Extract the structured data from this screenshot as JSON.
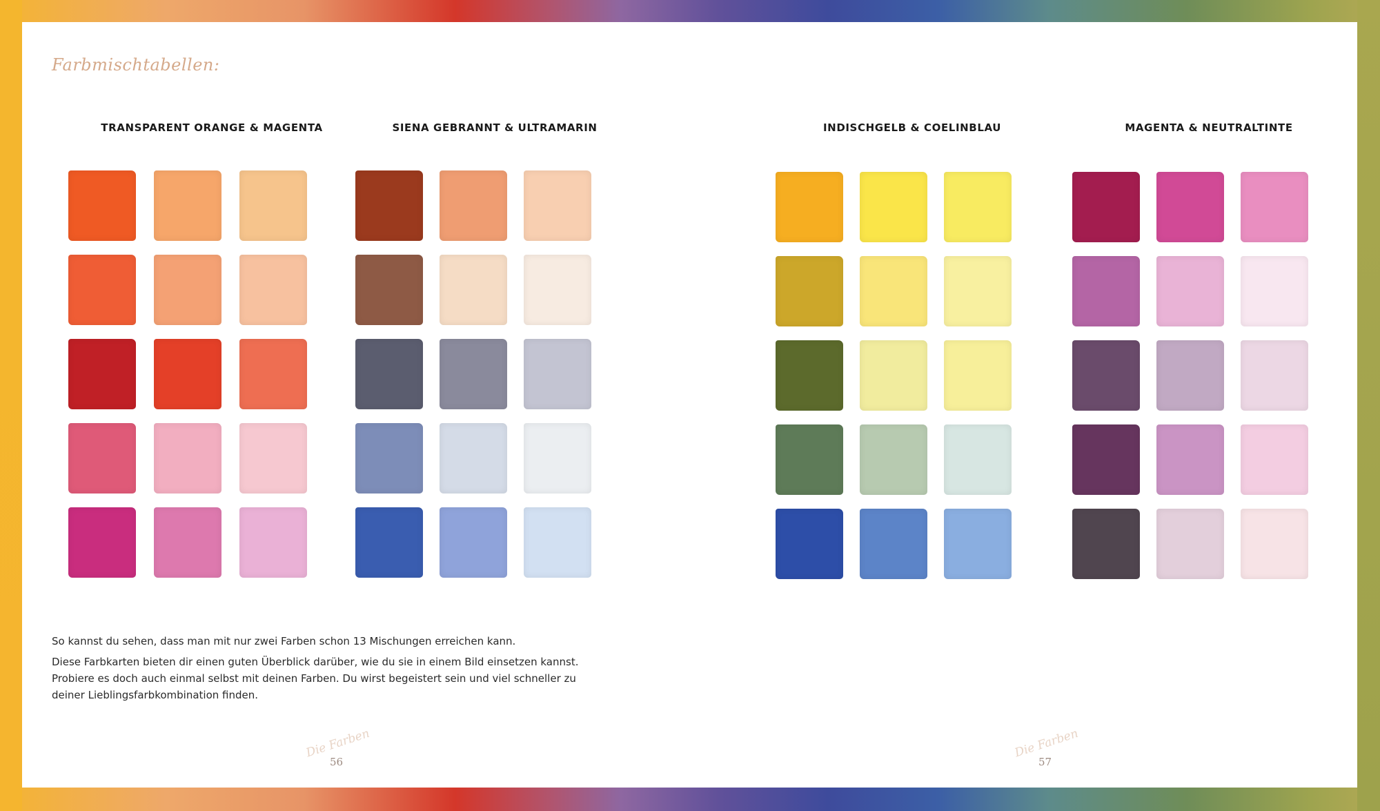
{
  "header": {
    "title": "Farbmischtabellen:"
  },
  "columns": [
    {
      "title": "TRANSPARENT ORANGE & MAGENTA",
      "swatches": [
        "#ef5a24",
        "#f6a66a",
        "#f6c48c",
        "#ef5d35",
        "#f4a174",
        "#f7c19f",
        "#c02026",
        "#e44028",
        "#ee6e52",
        "#df5a78",
        "#f2aec0",
        "#f6c8d0",
        "#c92d7e",
        "#dd79ae",
        "#eab1d6"
      ]
    },
    {
      "title": "SIENA GEBRANNT & ULTRAMARIN",
      "swatches": [
        "#9b3a1e",
        "#ef9d72",
        "#f8cfb1",
        "#8e5a45",
        "#f5dcc5",
        "#f7ebe1",
        "#5b5d6f",
        "#8a8a9c",
        "#c3c4d2",
        "#7d8db8",
        "#d4dbe7",
        "#ebeef1",
        "#3a5db0",
        "#8fa3da",
        "#d2e0f2"
      ]
    },
    {
      "title": "INDISCHGELB & COELINBLAU",
      "swatches": [
        "#f6ae21",
        "#fae549",
        "#f8eb61",
        "#cca72a",
        "#f9e579",
        "#f8f0a0",
        "#5c6a2c",
        "#f1ec9e",
        "#f7ef9a",
        "#5e7b58",
        "#b7cab0",
        "#d7e6e2",
        "#2d4ea8",
        "#5c84c8",
        "#8aaee0"
      ]
    },
    {
      "title": "MAGENTA & NEUTRALTINTE",
      "swatches": [
        "#a31d4f",
        "#d14a96",
        "#e98ec0",
        "#b465a5",
        "#e9b3d6",
        "#f8e7f0",
        "#6a4b6b",
        "#c1a9c3",
        "#ecd7e4",
        "#66355e",
        "#ca94c4",
        "#f3cde1",
        "#50454f",
        "#e3cfdb",
        "#f7e3e6"
      ]
    }
  ],
  "paragraphs": [
    "So kannst du sehen, dass man mit nur zwei Farben schon 13 Mischungen erreichen kann.",
    "Diese Farbkarten bieten dir einen guten Überblick darüber, wie du sie in einem Bild einsetzen kannst. Probiere es doch auch einmal selbst mit deinen Farben. Du wirst begeistert sein und viel schneller zu deiner Lieblingsfarbkombination finden."
  ],
  "footer": {
    "left_label": "Die Farben",
    "left_page": "56",
    "right_label": "Die Farben",
    "right_page": "57"
  }
}
